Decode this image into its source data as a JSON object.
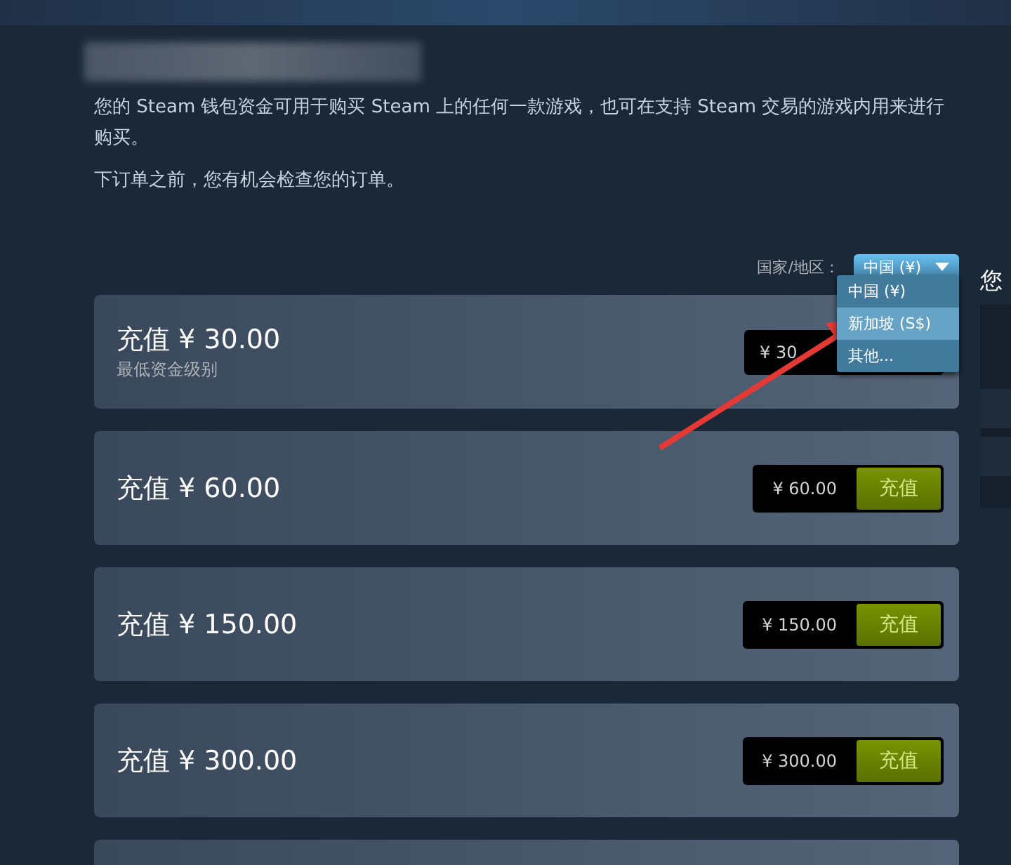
{
  "intro": {
    "paragraphs": [
      "您的 Steam 钱包资金可用于购买 Steam 上的任何一款游戏，也可在支持 Steam 交易的游戏内用来进行购买。",
      "下订单之前，您有机会检查您的订单。"
    ]
  },
  "region": {
    "label": "国家/地区：",
    "value": "中国 (¥)",
    "expanded": true,
    "options": [
      {
        "label": "中国 (¥)",
        "highlighted": false
      },
      {
        "label": "新加坡 (S$)",
        "highlighted": true
      },
      {
        "label": "其他...",
        "highlighted": false
      }
    ]
  },
  "side_panel": {
    "heading": "您"
  },
  "cards": [
    {
      "title": "充值 ¥ 30.00",
      "note": "最低资金级别",
      "price": "¥ 30"
    },
    {
      "title": "充值 ¥ 60.00",
      "price": "¥ 60.00",
      "button": "充值"
    },
    {
      "title": "充值 ¥ 150.00",
      "price": "¥ 150.00",
      "button": "充值"
    },
    {
      "title": "充值 ¥ 300.00",
      "price": "¥ 300.00",
      "button": "充值"
    }
  ],
  "annotation": {
    "kind": "arrow"
  }
}
